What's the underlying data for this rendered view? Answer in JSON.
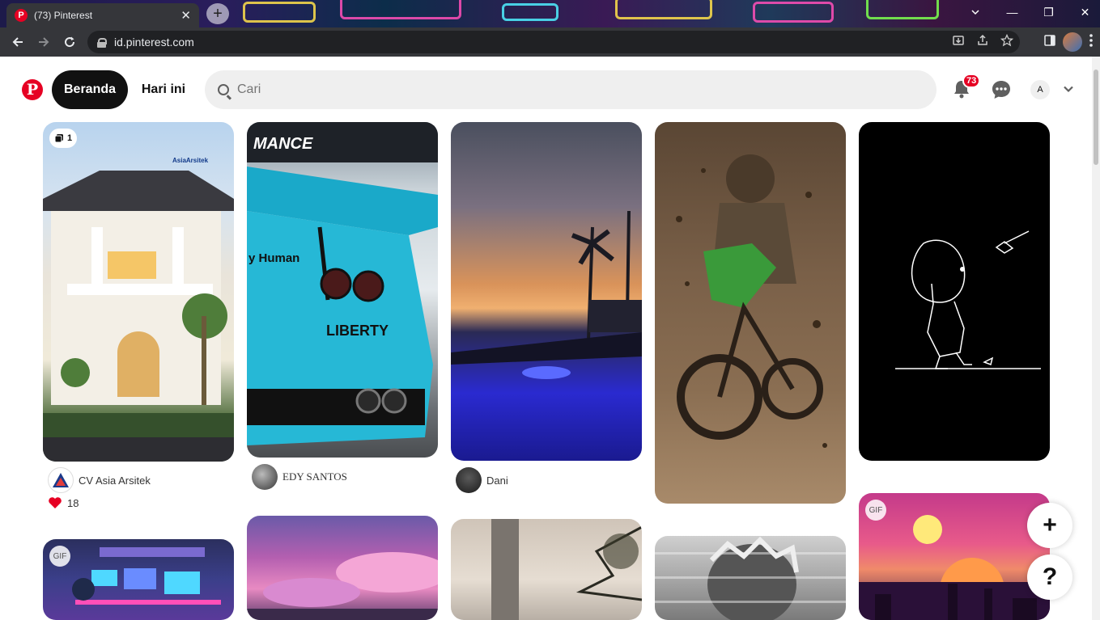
{
  "browser": {
    "tab_title": "(73) Pinterest",
    "tab_favicon": "P",
    "tab_close": "✕",
    "new_tab": "+",
    "url": "id.pinterest.com",
    "win_min": "—",
    "win_restore": "❐",
    "win_close": "✕"
  },
  "header": {
    "logo": "P",
    "home_label": "Beranda",
    "today_label": "Hari ini",
    "search_placeholder": "Cari",
    "notif_count": "73",
    "user_initial": "A"
  },
  "pins": {
    "p1_tag": "1",
    "p1_author": "CV Asia Arsitek",
    "p1_brand": "AsiaArsitek",
    "p1_likes": "18",
    "p2_author": "EDY SANTOS",
    "p2_text1": "MANCE",
    "p2_text2": "y Human",
    "p2_text3": "LIBERTY",
    "p3_author": "Dani",
    "gif1": "GIF",
    "gif2": "GIF"
  },
  "fab": {
    "add": "+",
    "help": "?"
  },
  "colors": {
    "brand": "#e60023"
  }
}
